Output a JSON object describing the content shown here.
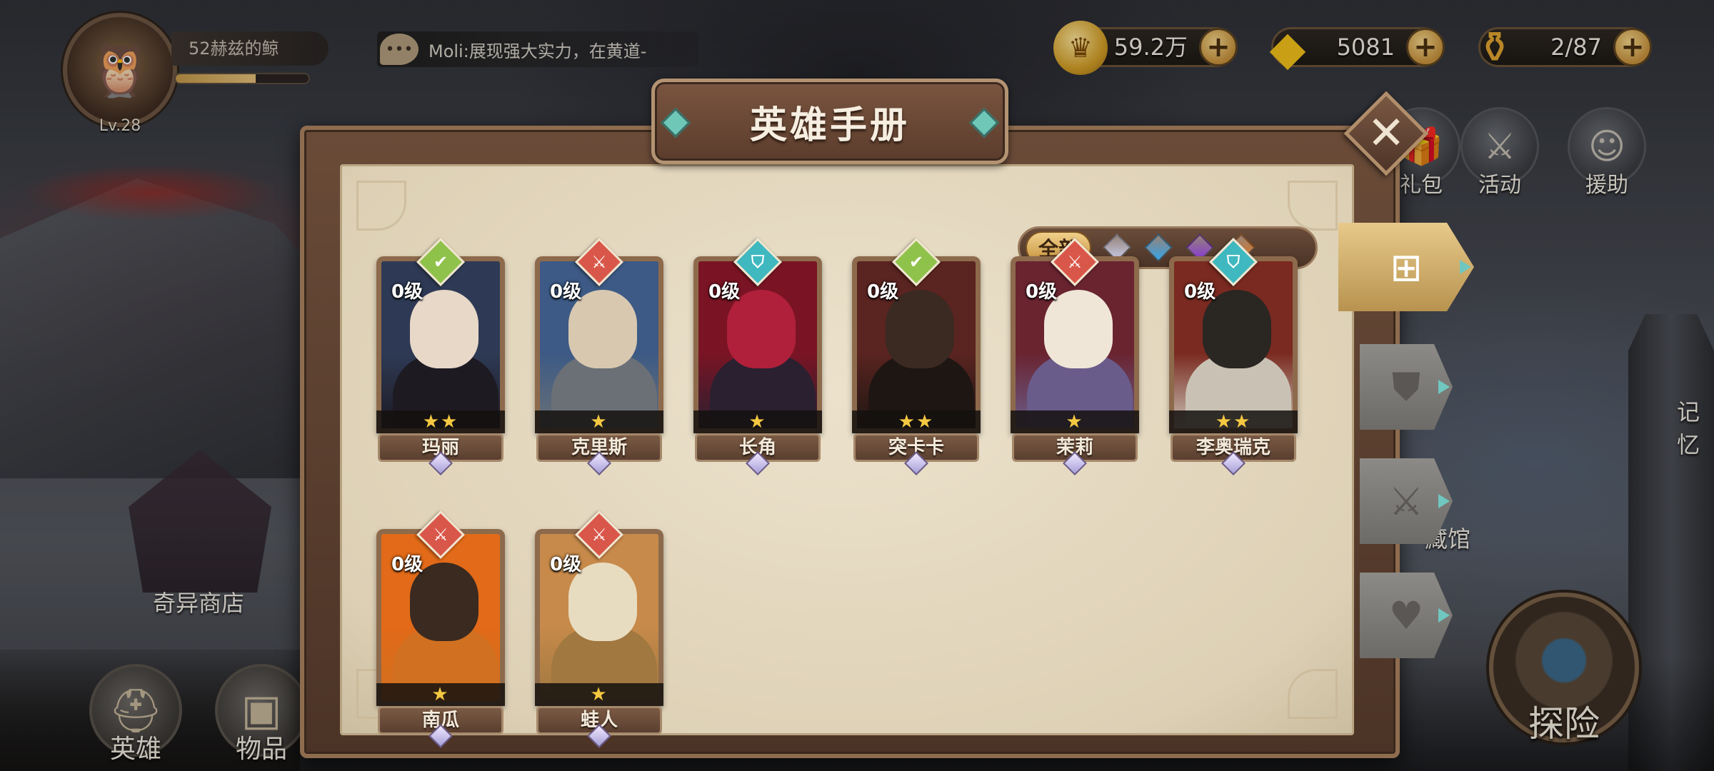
{
  "player": {
    "name": "52赫兹的鲸",
    "level": "Lv.28",
    "xp_fraction": 0.6
  },
  "chat": {
    "message": "Moli:展现强大实力，在黄道-"
  },
  "resources": [
    {
      "name": "gold-coin",
      "value": "59.2万"
    },
    {
      "name": "diamond",
      "value": "5081"
    },
    {
      "name": "stamina-food",
      "value": "2/87"
    }
  ],
  "right_menu": {
    "gift": "礼包",
    "event": "活动",
    "assist": "援助",
    "memory": "记忆",
    "collection": "藏馆"
  },
  "map_labels": {
    "shop": "奇异商店"
  },
  "bottom_nav": {
    "heroes": "英雄",
    "items": "物品",
    "explore": "探险"
  },
  "modal": {
    "title": "英雄手册",
    "filter_all": "全部",
    "filter_gems": [
      "#cdd0ee",
      "#3aa6e8",
      "#8a3ad8",
      "#e87a20"
    ]
  },
  "heroes": [
    {
      "name": "玛丽",
      "level": "0级",
      "stars": "★★",
      "class_color": "#8fc24a",
      "class_icon": "✔",
      "palette": [
        "#2e3a55",
        "#1d1a22",
        "#e8d8c8"
      ]
    },
    {
      "name": "克里斯",
      "level": "0级",
      "stars": "★",
      "class_color": "#d9574a",
      "class_icon": "⚔",
      "palette": [
        "#3c5a85",
        "#6a7076",
        "#d8c8b0"
      ]
    },
    {
      "name": "长角",
      "level": "0级",
      "stars": "★",
      "class_color": "#3fb8c0",
      "class_icon": "⛉",
      "palette": [
        "#7a1424",
        "#2a2030",
        "#b0203a"
      ]
    },
    {
      "name": "突卡卡",
      "level": "0级",
      "stars": "★★",
      "class_color": "#8fc24a",
      "class_icon": "✔",
      "palette": [
        "#5a2420",
        "#1e1612",
        "#3a2a22"
      ]
    },
    {
      "name": "茉莉",
      "level": "0级",
      "stars": "★",
      "class_color": "#d9574a",
      "class_icon": "⚔",
      "palette": [
        "#6a2430",
        "#6a5c8a",
        "#efe6d8"
      ]
    },
    {
      "name": "李奥瑞克",
      "level": "0级",
      "stars": "★★",
      "class_color": "#3fb8c0",
      "class_icon": "⛉",
      "palette": [
        "#7a2a20",
        "#c9c2b4",
        "#2a2622"
      ]
    },
    {
      "name": "南瓜",
      "level": "0级",
      "stars": "★",
      "class_color": "#d9574a",
      "class_icon": "⚔",
      "palette": [
        "#e26a18",
        "#d07020",
        "#3a2a20"
      ]
    },
    {
      "name": "蛙人",
      "level": "0级",
      "stars": "★",
      "class_color": "#d9574a",
      "class_icon": "⚔",
      "palette": [
        "#c78a4a",
        "#a07840",
        "#e8dcc0"
      ]
    }
  ]
}
